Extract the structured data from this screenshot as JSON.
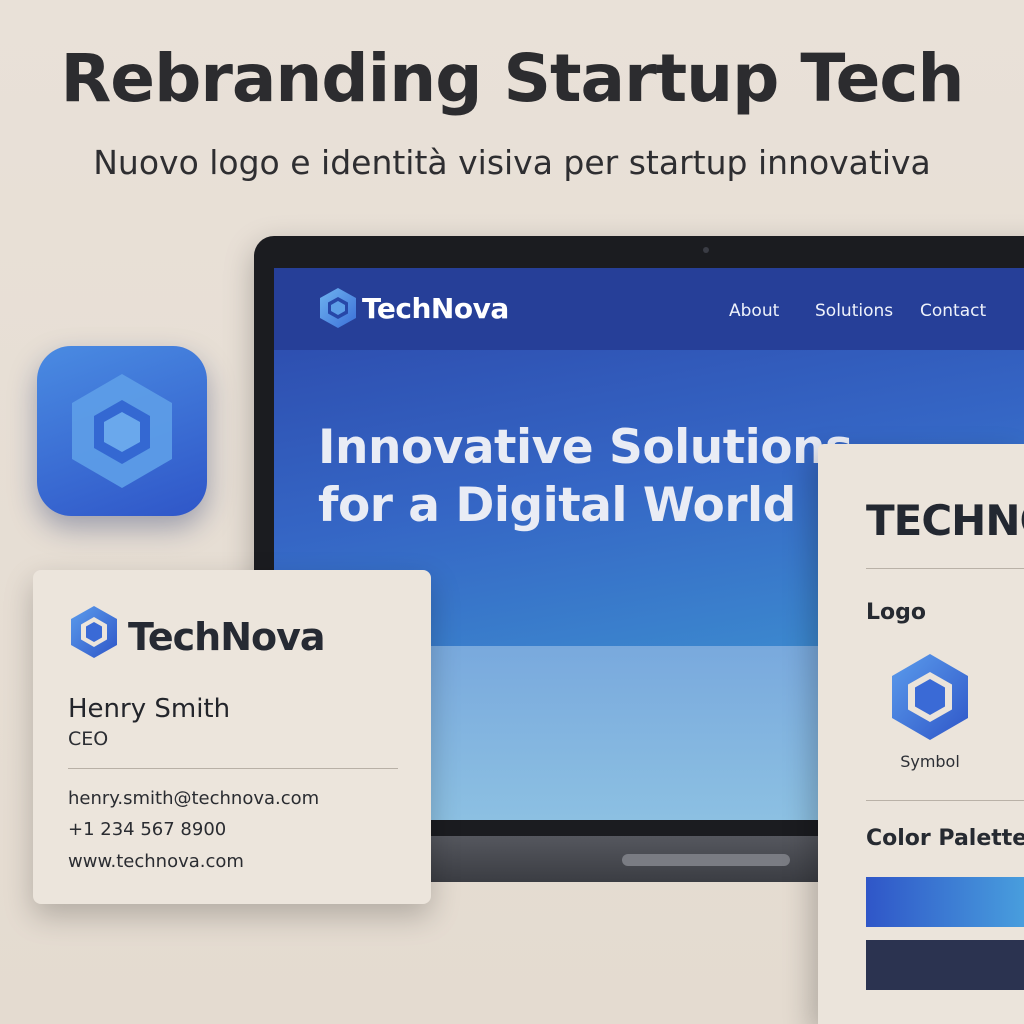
{
  "header": {
    "title": "Rebranding Startup Tech",
    "subtitle": "Nuovo logo e identità visiva per startup innovativa"
  },
  "website": {
    "brand": "TechNova",
    "nav": [
      "About",
      "Solutions",
      "Contact"
    ],
    "hero_line1": "Innovative Solutions",
    "hero_line2": "for a Digital World"
  },
  "business_card": {
    "brand": "TechNova",
    "name": "Henry Smith",
    "role": "CEO",
    "email": "henry.smith@technova.com",
    "phone": "+1 234 567 8900",
    "website": "www.technova.com"
  },
  "brand_guide": {
    "title": "TECHNO",
    "logo_heading": "Logo",
    "logo_caption": "Symbol",
    "palette_heading": "Color Palette"
  },
  "colors": {
    "primary_gradient_start": "#2f56c8",
    "primary_gradient_end": "#4aa3df",
    "navy": "#2b3350",
    "background": "#e9e1d8"
  },
  "icons": {
    "logo": "hexagon-logo-icon",
    "app_icon": "hexagon-app-icon"
  }
}
